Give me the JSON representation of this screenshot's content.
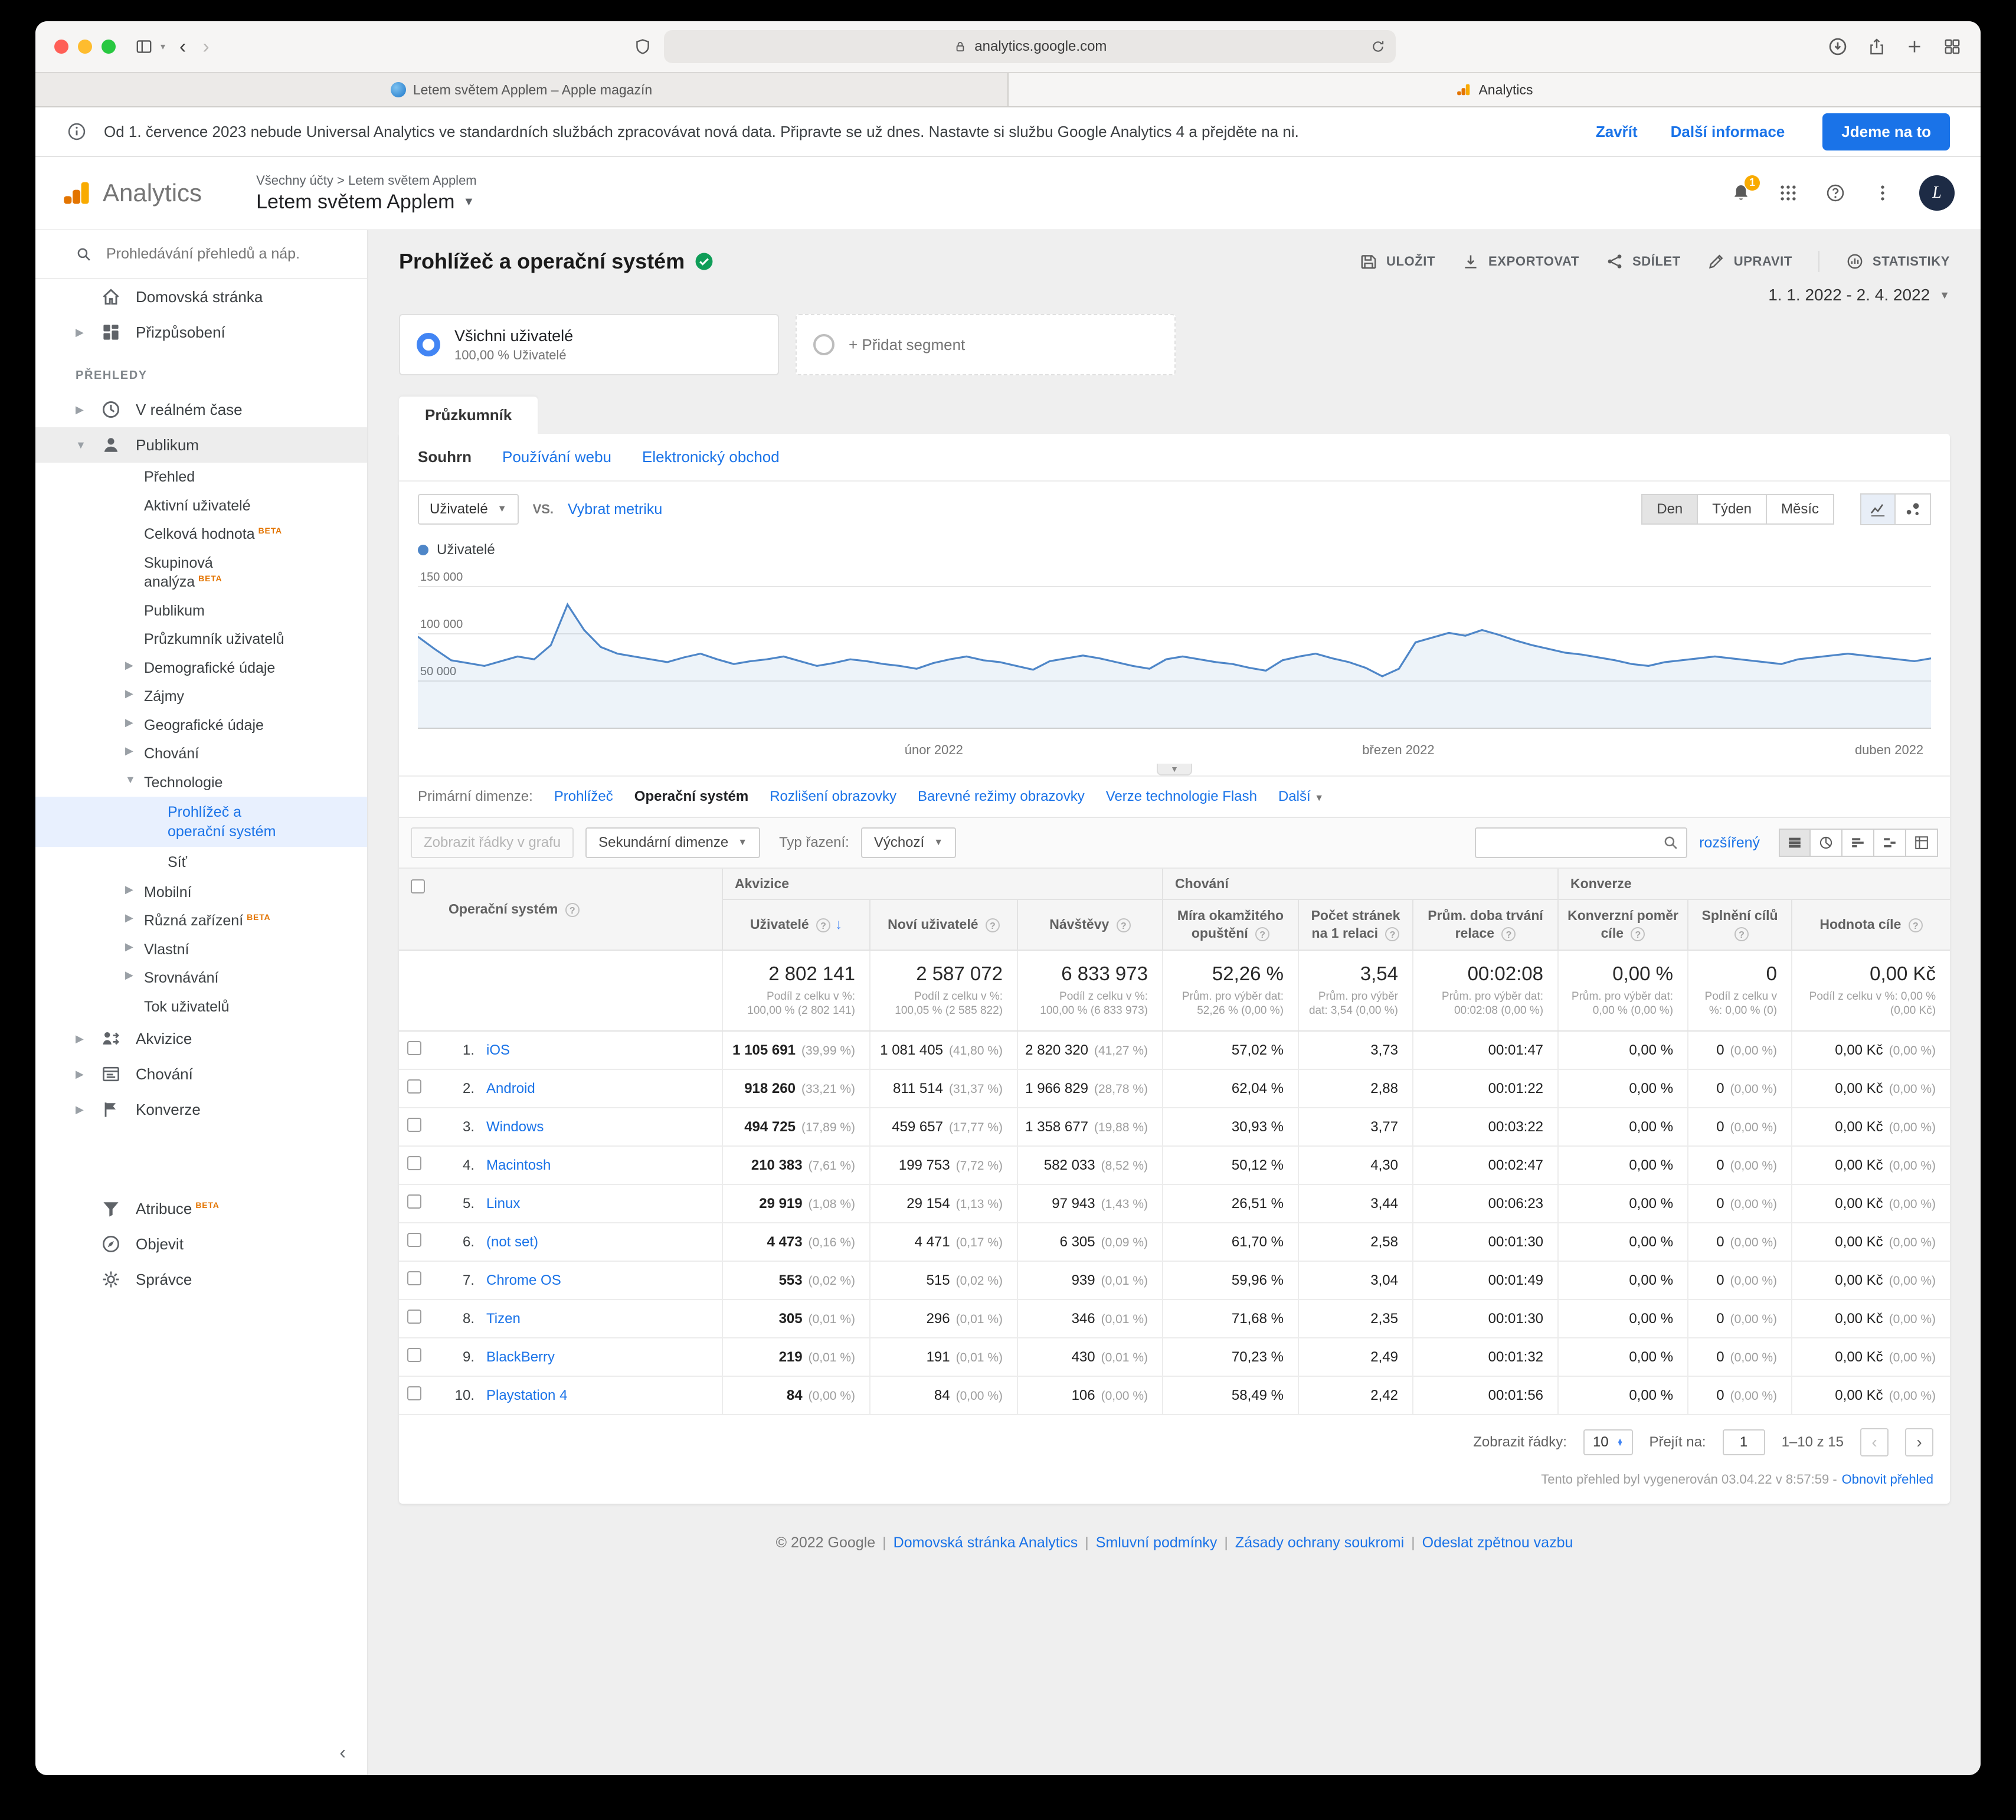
{
  "browser": {
    "url": "analytics.google.com",
    "tabs": [
      {
        "label": "Letem světem Applem – Apple magazín"
      },
      {
        "label": "Analytics"
      }
    ]
  },
  "banner": {
    "message": "Od 1. července 2023 nebude Universal Analytics ve standardních službách zpracovávat nová data. Připravte se už dnes. Nastavte si službu Google Analytics 4 a přejděte na ni.",
    "dismiss": "Zavřít",
    "more_info": "Další informace",
    "cta": "Jdeme na to"
  },
  "header": {
    "product": "Analytics",
    "breadcrumb": "Všechny účty > Letem světem Applem",
    "account": "Letem světem Applem",
    "notification_count": "1",
    "avatar_initial": "L"
  },
  "sidebar": {
    "search_placeholder": "Prohledávání přehledů a náp.",
    "items": [
      {
        "label": "Domovská stránka",
        "icon": "home",
        "type": "top"
      },
      {
        "label": "Přizpůsobení",
        "icon": "customization",
        "type": "top",
        "expandable": true
      },
      {
        "label": "PŘEHLEDY",
        "type": "section"
      },
      {
        "label": "V reálném čase",
        "icon": "clock",
        "type": "top",
        "expandable": true
      },
      {
        "label": "Publikum",
        "icon": "person",
        "type": "top",
        "expandable": true,
        "expanded": true,
        "active": true
      },
      {
        "label": "Přehled",
        "type": "child"
      },
      {
        "label": "Aktivní uživatelé",
        "type": "child"
      },
      {
        "label": "Celková hodnota",
        "badge": "BETA",
        "type": "child"
      },
      {
        "label": "Skupinová analýza",
        "badge": "BETA",
        "type": "child"
      },
      {
        "label": "Publikum",
        "type": "child"
      },
      {
        "label": "Průzkumník uživatelů",
        "type": "child"
      },
      {
        "label": "Demografické údaje",
        "type": "child",
        "expandable": true
      },
      {
        "label": "Zájmy",
        "type": "child",
        "expandable": true
      },
      {
        "label": "Geografické údaje",
        "type": "child",
        "expandable": true
      },
      {
        "label": "Chování",
        "type": "child",
        "expandable": true
      },
      {
        "label": "Technologie",
        "type": "child",
        "expandable": true,
        "expanded": true
      },
      {
        "label": "Prohlížeč a operační systém",
        "type": "grand",
        "selected": true
      },
      {
        "label": "Síť",
        "type": "grand"
      },
      {
        "label": "Mobilní",
        "type": "child",
        "expandable": true
      },
      {
        "label": "Různá zařízení",
        "badge": "BETA",
        "type": "child",
        "expandable": true
      },
      {
        "label": "Vlastní",
        "type": "child",
        "expandable": true
      },
      {
        "label": "Srovnávání",
        "type": "child",
        "expandable": true
      },
      {
        "label": "Tok uživatelů",
        "type": "child"
      },
      {
        "label": "Akvizice",
        "icon": "acquisition",
        "type": "top",
        "expandable": true
      },
      {
        "label": "Chování",
        "icon": "behavior",
        "type": "top",
        "expandable": true
      },
      {
        "label": "Konverze",
        "icon": "flag",
        "type": "top",
        "expandable": true
      },
      {
        "label": "Atribuce",
        "badge": "BETA",
        "icon": "attribution",
        "type": "top",
        "gap_before": true
      },
      {
        "label": "Objevit",
        "icon": "discover",
        "type": "top"
      },
      {
        "label": "Správce",
        "icon": "gear",
        "type": "top"
      }
    ]
  },
  "report": {
    "title": "Prohlížeč a operační systém",
    "actions": [
      {
        "label": "ULOŽIT",
        "icon": "save"
      },
      {
        "label": "EXPORTOVAT",
        "icon": "export"
      },
      {
        "label": "SDÍLET",
        "icon": "share"
      },
      {
        "label": "UPRAVIT",
        "icon": "edit"
      },
      {
        "label": "STATISTIKY",
        "icon": "insights",
        "divider": true
      }
    ],
    "date_range": "1. 1. 2022 - 2. 4. 2022",
    "segments": {
      "active": {
        "title": "Všichni uživatelé",
        "subtitle": "100,00 % Uživatelé"
      },
      "add_label": "+ Přidat segment"
    },
    "tab": "Průzkumník",
    "subtabs": [
      {
        "label": "Souhrn",
        "active": true
      },
      {
        "label": "Používání webu"
      },
      {
        "label": "Elektronický obchod"
      }
    ],
    "metric_picker": {
      "selected": "Uživatelé",
      "vs": "VS.",
      "choose": "Vybrat metriku"
    },
    "granularity": [
      {
        "label": "Den",
        "active": true
      },
      {
        "label": "Týden"
      },
      {
        "label": "Měsíc"
      }
    ],
    "legend": "Uživatelé",
    "dimensions": {
      "label": "Primární dimenze:",
      "options": [
        {
          "label": "Prohlížeč"
        },
        {
          "label": "Operační systém",
          "selected": true
        },
        {
          "label": "Rozlišení obrazovky"
        },
        {
          "label": "Barevné režimy obrazovky"
        },
        {
          "label": "Verze technologie Flash"
        },
        {
          "label": "Další",
          "caret": true
        }
      ]
    },
    "controls": {
      "plot_rows": "Zobrazit řádky v grafu",
      "secondary_dimension": "Sekundární dimenze",
      "sort_label": "Typ řazení:",
      "sort_value": "Výchozí",
      "advanced": "rozšířený"
    },
    "pagination": {
      "rows_label": "Zobrazit řádky:",
      "rows_value": "10",
      "goto_label": "Přejít na:",
      "goto_value": "1",
      "range": "1–10 z 15"
    },
    "generated_note": "Tento přehled byl vygenerován 03.04.22 v 8:57:59 -",
    "refresh_link": "Obnovit přehled"
  },
  "chart_data": {
    "type": "line",
    "title": "Uživatelé",
    "x_start": "1. 1. 2022",
    "x_end": "2. 4. 2022",
    "x_ticks": [
      {
        "label": "únor 2022",
        "frac": 0.341
      },
      {
        "label": "březen 2022",
        "frac": 0.648
      },
      {
        "label": "duben 2022",
        "frac": 0.995
      }
    ],
    "ylim": [
      0,
      150000
    ],
    "y_ticks": [
      {
        "value": 50000,
        "label": "50 000"
      },
      {
        "value": 100000,
        "label": "100 000"
      },
      {
        "value": 150000,
        "label": "150 000"
      }
    ],
    "grid": true,
    "legend_position": "top-left",
    "series": [
      {
        "name": "Uživatelé",
        "color": "#4e86c8",
        "values": [
          97000,
          84000,
          72000,
          69000,
          66000,
          71000,
          76000,
          73000,
          88000,
          131000,
          104000,
          86000,
          79000,
          76000,
          73000,
          70000,
          75000,
          79000,
          73000,
          68000,
          71000,
          73000,
          76000,
          71000,
          66000,
          69000,
          73000,
          71000,
          68000,
          66000,
          63000,
          69000,
          73000,
          76000,
          72000,
          70000,
          66000,
          62000,
          71000,
          74000,
          77000,
          74000,
          70000,
          66000,
          63000,
          73000,
          76000,
          73000,
          70000,
          68000,
          64000,
          61000,
          72000,
          76000,
          79000,
          74000,
          70000,
          64000,
          55000,
          63000,
          91000,
          96000,
          101000,
          98000,
          104000,
          99000,
          93000,
          88000,
          84000,
          80000,
          78000,
          75000,
          72000,
          68000,
          66000,
          70000,
          72000,
          74000,
          76000,
          74000,
          72000,
          70000,
          68000,
          73000,
          75000,
          77000,
          79000,
          77000,
          75000,
          73000,
          71000,
          74000
        ]
      }
    ]
  },
  "table": {
    "dimension": "Operační systém",
    "groups": [
      {
        "label": "Akvizice",
        "span": 3
      },
      {
        "label": "Chování",
        "span": 3
      },
      {
        "label": "Konverze",
        "span": 3
      }
    ],
    "columns": [
      "Uživatelé",
      "Noví uživatelé",
      "Návštěvy",
      "Míra okamžitého opuštění",
      "Počet stránek na 1 relaci",
      "Prům. doba trvání relace",
      "Konverzní poměr cíle",
      "Splnění cílů",
      "Hodnota cíle"
    ],
    "sorted_column": 0,
    "totals": {
      "values": [
        "2 802 141",
        "2 587 072",
        "6 833 973",
        "52,26 %",
        "3,54",
        "00:02:08",
        "0,00 %",
        "0",
        "0,00 Kč"
      ],
      "notes": [
        "Podíl z celku v %: 100,00 % (2 802 141)",
        "Podíl z celku v %: 100,05 % (2 585 822)",
        "Podíl z celku v %: 100,00 % (6 833 973)",
        "Prům. pro výběr dat: 52,26 % (0,00 %)",
        "Prům. pro výběr dat: 3,54 (0,00 %)",
        "Prům. pro výběr dat: 00:02:08 (0,00 %)",
        "Prům. pro výběr dat: 0,00 % (0,00 %)",
        "Podíl z celku v %: 0,00 % (0)",
        "Podíl z celku v %: 0,00 % (0,00 Kč)"
      ]
    },
    "rows": [
      {
        "rank": "1.",
        "name": "iOS",
        "metrics": [
          [
            "1 105 691",
            "(39,99 %)"
          ],
          [
            "1 081 405",
            "(41,80 %)"
          ],
          [
            "2 820 320",
            "(41,27 %)"
          ],
          [
            "57,02 %",
            ""
          ],
          [
            "3,73",
            ""
          ],
          [
            "00:01:47",
            ""
          ],
          [
            "0,00 %",
            ""
          ],
          [
            "0",
            "(0,00 %)"
          ],
          [
            "0,00 Kč",
            "(0,00 %)"
          ]
        ]
      },
      {
        "rank": "2.",
        "name": "Android",
        "metrics": [
          [
            "918 260",
            "(33,21 %)"
          ],
          [
            "811 514",
            "(31,37 %)"
          ],
          [
            "1 966 829",
            "(28,78 %)"
          ],
          [
            "62,04 %",
            ""
          ],
          [
            "2,88",
            ""
          ],
          [
            "00:01:22",
            ""
          ],
          [
            "0,00 %",
            ""
          ],
          [
            "0",
            "(0,00 %)"
          ],
          [
            "0,00 Kč",
            "(0,00 %)"
          ]
        ]
      },
      {
        "rank": "3.",
        "name": "Windows",
        "metrics": [
          [
            "494 725",
            "(17,89 %)"
          ],
          [
            "459 657",
            "(17,77 %)"
          ],
          [
            "1 358 677",
            "(19,88 %)"
          ],
          [
            "30,93 %",
            ""
          ],
          [
            "3,77",
            ""
          ],
          [
            "00:03:22",
            ""
          ],
          [
            "0,00 %",
            ""
          ],
          [
            "0",
            "(0,00 %)"
          ],
          [
            "0,00 Kč",
            "(0,00 %)"
          ]
        ]
      },
      {
        "rank": "4.",
        "name": "Macintosh",
        "metrics": [
          [
            "210 383",
            "(7,61 %)"
          ],
          [
            "199 753",
            "(7,72 %)"
          ],
          [
            "582 033",
            "(8,52 %)"
          ],
          [
            "50,12 %",
            ""
          ],
          [
            "4,30",
            ""
          ],
          [
            "00:02:47",
            ""
          ],
          [
            "0,00 %",
            ""
          ],
          [
            "0",
            "(0,00 %)"
          ],
          [
            "0,00 Kč",
            "(0,00 %)"
          ]
        ]
      },
      {
        "rank": "5.",
        "name": "Linux",
        "metrics": [
          [
            "29 919",
            "(1,08 %)"
          ],
          [
            "29 154",
            "(1,13 %)"
          ],
          [
            "97 943",
            "(1,43 %)"
          ],
          [
            "26,51 %",
            ""
          ],
          [
            "3,44",
            ""
          ],
          [
            "00:06:23",
            ""
          ],
          [
            "0,00 %",
            ""
          ],
          [
            "0",
            "(0,00 %)"
          ],
          [
            "0,00 Kč",
            "(0,00 %)"
          ]
        ]
      },
      {
        "rank": "6.",
        "name": "(not set)",
        "metrics": [
          [
            "4 473",
            "(0,16 %)"
          ],
          [
            "4 471",
            "(0,17 %)"
          ],
          [
            "6 305",
            "(0,09 %)"
          ],
          [
            "61,70 %",
            ""
          ],
          [
            "2,58",
            ""
          ],
          [
            "00:01:30",
            ""
          ],
          [
            "0,00 %",
            ""
          ],
          [
            "0",
            "(0,00 %)"
          ],
          [
            "0,00 Kč",
            "(0,00 %)"
          ]
        ]
      },
      {
        "rank": "7.",
        "name": "Chrome OS",
        "metrics": [
          [
            "553",
            "(0,02 %)"
          ],
          [
            "515",
            "(0,02 %)"
          ],
          [
            "939",
            "(0,01 %)"
          ],
          [
            "59,96 %",
            ""
          ],
          [
            "3,04",
            ""
          ],
          [
            "00:01:49",
            ""
          ],
          [
            "0,00 %",
            ""
          ],
          [
            "0",
            "(0,00 %)"
          ],
          [
            "0,00 Kč",
            "(0,00 %)"
          ]
        ]
      },
      {
        "rank": "8.",
        "name": "Tizen",
        "metrics": [
          [
            "305",
            "(0,01 %)"
          ],
          [
            "296",
            "(0,01 %)"
          ],
          [
            "346",
            "(0,01 %)"
          ],
          [
            "71,68 %",
            ""
          ],
          [
            "2,35",
            ""
          ],
          [
            "00:01:30",
            ""
          ],
          [
            "0,00 %",
            ""
          ],
          [
            "0",
            "(0,00 %)"
          ],
          [
            "0,00 Kč",
            "(0,00 %)"
          ]
        ]
      },
      {
        "rank": "9.",
        "name": "BlackBerry",
        "metrics": [
          [
            "219",
            "(0,01 %)"
          ],
          [
            "191",
            "(0,01 %)"
          ],
          [
            "430",
            "(0,01 %)"
          ],
          [
            "70,23 %",
            ""
          ],
          [
            "2,49",
            ""
          ],
          [
            "00:01:32",
            ""
          ],
          [
            "0,00 %",
            ""
          ],
          [
            "0",
            "(0,00 %)"
          ],
          [
            "0,00 Kč",
            "(0,00 %)"
          ]
        ]
      },
      {
        "rank": "10.",
        "name": "Playstation 4",
        "metrics": [
          [
            "84",
            "(0,00 %)"
          ],
          [
            "84",
            "(0,00 %)"
          ],
          [
            "106",
            "(0,00 %)"
          ],
          [
            "58,49 %",
            ""
          ],
          [
            "2,42",
            ""
          ],
          [
            "00:01:56",
            ""
          ],
          [
            "0,00 %",
            ""
          ],
          [
            "0",
            "(0,00 %)"
          ],
          [
            "0,00 Kč",
            "(0,00 %)"
          ]
        ]
      }
    ]
  },
  "footer": {
    "copyright": "© 2022 Google",
    "links": [
      "Domovská stránka Analytics",
      "Smluvní podmínky",
      "Zásady ochrany soukromi",
      "Odeslat zpětnou vazbu"
    ]
  }
}
